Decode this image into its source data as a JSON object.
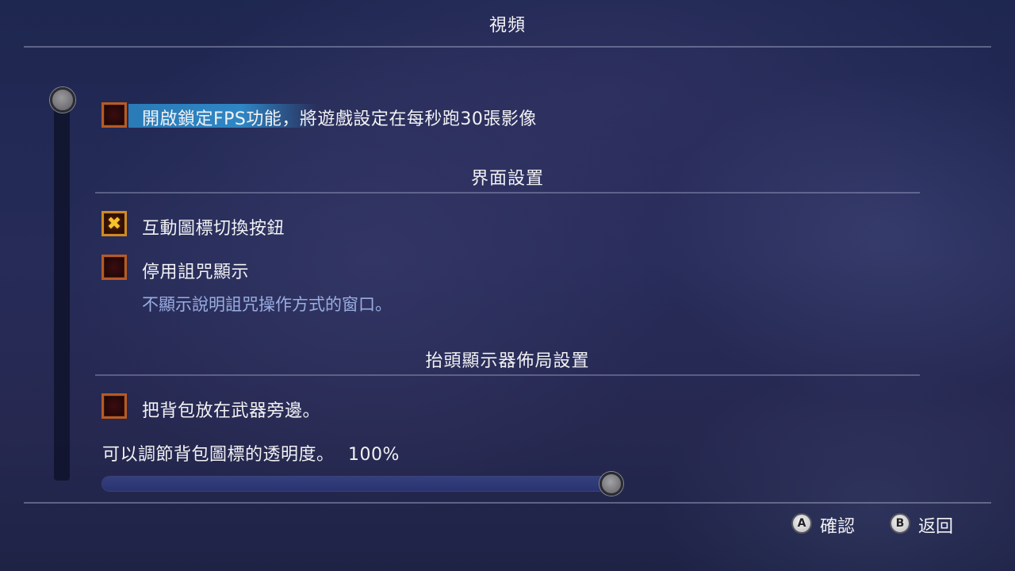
{
  "header": {
    "title": "視頻"
  },
  "options": {
    "fps_lock": {
      "label": "開啟鎖定FPS功能，將遊戲設定在每秒跑30張影像",
      "checked": false
    },
    "interact_icon_toggle": {
      "label": "互動圖標切換按鈕",
      "checked": true
    },
    "disable_curse_display": {
      "label": "停用詛咒顯示",
      "checked": false,
      "description": "不顯示說明詛咒操作方式的窗口。"
    },
    "backpack_beside_weapon": {
      "label": "把背包放在武器旁邊。",
      "checked": false
    }
  },
  "sections": {
    "interface": "界面設置",
    "hud_layout": "抬頭顯示器佈局設置"
  },
  "opacity_slider": {
    "label": "可以調節背包圖標的透明度。",
    "value_text": "100%",
    "value": 100
  },
  "footer": {
    "confirm": {
      "glyph": "A",
      "label": "確認"
    },
    "back": {
      "glyph": "B",
      "label": "返回"
    }
  },
  "check_glyph": "✖",
  "colors": {
    "highlight": "#2f86c4",
    "checkbox_border": "#b85a24",
    "check_mark": "#f4c22c",
    "description_text": "#9aaee2"
  }
}
